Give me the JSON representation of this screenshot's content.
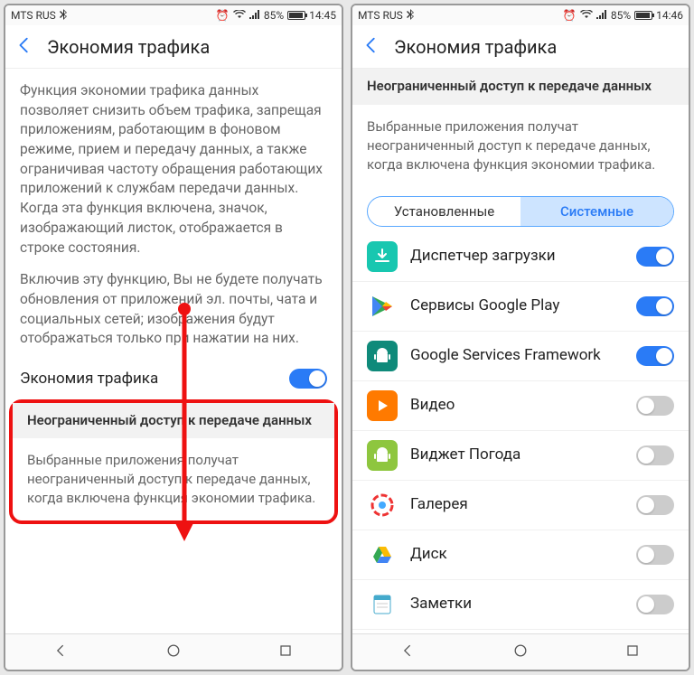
{
  "left": {
    "status": {
      "carrier": "MTS RUS",
      "battery": "85%",
      "time": "14:45"
    },
    "header": {
      "title": "Экономия трафика"
    },
    "desc1": "Функция экономии трафика данных позволяет снизить объем трафика, запрещая приложениям, работающим в фоновом режиме, прием и передачу данных, а также ограничивая частоту обращения работающих приложений к службам передачи данных. Когда эта функция включена, значок, изображающий листок, отображается в строке состояния.",
    "desc2": "Включив эту функцию, Вы не будете получать обновления от приложений эл. почты, чата и социальных сетей; изображения будут отображаться только при нажатии на них.",
    "toggle_label": "Экономия трафика",
    "section_header": "Неограниченный доступ к передаче данных",
    "section_desc": "Выбранные приложения получат неограниченный доступ к передаче данных, когда включена функция экономии трафика."
  },
  "right": {
    "status": {
      "carrier": "MTS RUS",
      "battery": "85%",
      "time": "14:46"
    },
    "header": {
      "title": "Экономия трафика"
    },
    "section_header": "Неограниченный доступ к передаче данных",
    "section_desc": "Выбранные приложения получат неограниченный доступ к передаче данных, когда включена функция экономии трафика.",
    "tabs": {
      "installed": "Установленные",
      "system": "Системные"
    },
    "apps": [
      {
        "label": "Диспетчер загрузки",
        "on": true,
        "icon": "download",
        "bg": "#18c7b0"
      },
      {
        "label": "Сервисы Google Play",
        "on": true,
        "icon": "play",
        "bg": "#fff"
      },
      {
        "label": "Google Services Framework",
        "on": true,
        "icon": "android",
        "bg": "#0f8a7a"
      },
      {
        "label": "Видео",
        "on": false,
        "icon": "video",
        "bg": "#ff7a00"
      },
      {
        "label": "Виджет Погода",
        "on": false,
        "icon": "android",
        "bg": "#8ec63f"
      },
      {
        "label": "Галерея",
        "on": false,
        "icon": "gallery",
        "bg": "#fff"
      },
      {
        "label": "Диск",
        "on": false,
        "icon": "drive",
        "bg": "#fff"
      },
      {
        "label": "Заметки",
        "on": false,
        "icon": "notes",
        "bg": "#fff"
      }
    ]
  }
}
